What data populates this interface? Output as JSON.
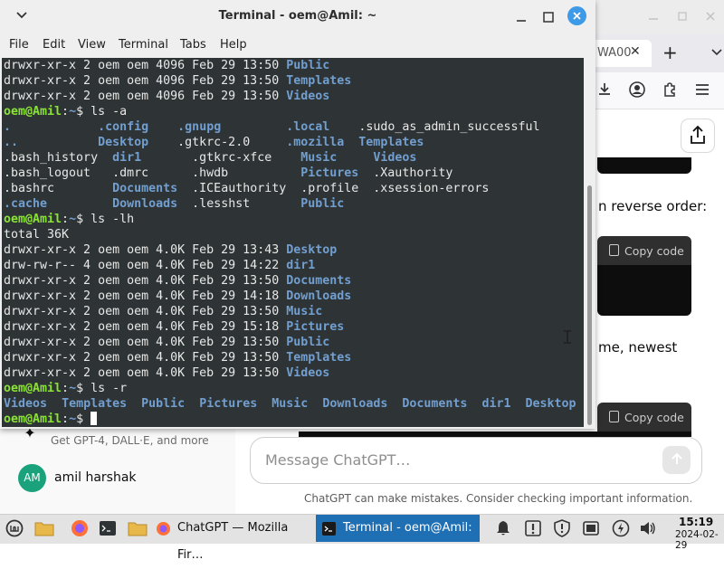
{
  "browser": {
    "tab_title": "WA00",
    "tab_close": "✕",
    "new_tab": "+",
    "content": {
      "text_reverse": "n reverse order:",
      "text_newest": "me, newest",
      "copy_code_1": "Copy code",
      "copy_code_2": "Copy code",
      "upgrade_subtitle": "Get GPT-4, DALL·E, and more",
      "user_initials": "AM",
      "user_name": "amil harshak",
      "message_placeholder": "Message ChatGPT…",
      "disclaimer": "ChatGPT can make mistakes. Consider checking important information."
    }
  },
  "terminal": {
    "title": "Terminal - oem@Amil: ~",
    "menu": [
      "File",
      "Edit",
      "View",
      "Terminal",
      "Tabs",
      "Help"
    ],
    "lines": [
      [
        {
          "t": "drwxr-xr-x 2 oem oem 4096 Feb 29 13:50 "
        },
        {
          "t": "Public",
          "c": "dir"
        }
      ],
      [
        {
          "t": "drwxr-xr-x 2 oem oem 4096 Feb 29 13:50 "
        },
        {
          "t": "Templates",
          "c": "dir"
        }
      ],
      [
        {
          "t": "drwxr-xr-x 2 oem oem 4096 Feb 29 13:50 "
        },
        {
          "t": "Videos",
          "c": "dir"
        }
      ],
      [
        {
          "t": "oem@Amil",
          "c": "prompt"
        },
        {
          "t": ":"
        },
        {
          "t": "~",
          "c": "dir"
        },
        {
          "t": "$ ls -a"
        }
      ],
      [
        {
          "t": ".",
          "c": "dir"
        },
        {
          "t": "            "
        },
        {
          "t": ".config",
          "c": "dir"
        },
        {
          "t": "    "
        },
        {
          "t": ".gnupg",
          "c": "dir"
        },
        {
          "t": "         "
        },
        {
          "t": ".local",
          "c": "dir"
        },
        {
          "t": "    .sudo_as_admin_successful"
        }
      ],
      [
        {
          "t": "..",
          "c": "dir"
        },
        {
          "t": "           "
        },
        {
          "t": "Desktop",
          "c": "dir"
        },
        {
          "t": "    .gtkrc-2.0     "
        },
        {
          "t": ".mozilla",
          "c": "dir"
        },
        {
          "t": "  "
        },
        {
          "t": "Templates",
          "c": "dir"
        }
      ],
      [
        {
          "t": ".bash_history  "
        },
        {
          "t": "dir1",
          "c": "dir"
        },
        {
          "t": "       .gtkrc-xfce    "
        },
        {
          "t": "Music",
          "c": "dir"
        },
        {
          "t": "     "
        },
        {
          "t": "Videos",
          "c": "dir"
        }
      ],
      [
        {
          "t": ".bash_logout   .dmrc      .hwdb          "
        },
        {
          "t": "Pictures",
          "c": "dir"
        },
        {
          "t": "  .Xauthority"
        }
      ],
      [
        {
          "t": ".bashrc        "
        },
        {
          "t": "Documents",
          "c": "dir"
        },
        {
          "t": "  .ICEauthority  .profile  .xsession-errors"
        }
      ],
      [
        {
          "t": ".cache",
          "c": "dir"
        },
        {
          "t": "         "
        },
        {
          "t": "Downloads",
          "c": "dir"
        },
        {
          "t": "  .lesshst       "
        },
        {
          "t": "Public",
          "c": "dir"
        }
      ],
      [
        {
          "t": "oem@Amil",
          "c": "prompt"
        },
        {
          "t": ":"
        },
        {
          "t": "~",
          "c": "dir"
        },
        {
          "t": "$ ls -lh"
        }
      ],
      [
        {
          "t": "total 36K"
        }
      ],
      [
        {
          "t": "drwxr-xr-x 2 oem oem 4.0K Feb 29 13:43 "
        },
        {
          "t": "Desktop",
          "c": "dir"
        }
      ],
      [
        {
          "t": "drw-rw-r-- 4 oem oem 4.0K Feb 29 14:22 "
        },
        {
          "t": "dir1",
          "c": "dir"
        }
      ],
      [
        {
          "t": "drwxr-xr-x 2 oem oem 4.0K Feb 29 13:50 "
        },
        {
          "t": "Documents",
          "c": "dir"
        }
      ],
      [
        {
          "t": "drwxr-xr-x 2 oem oem 4.0K Feb 29 14:18 "
        },
        {
          "t": "Downloads",
          "c": "dir"
        }
      ],
      [
        {
          "t": "drwxr-xr-x 2 oem oem 4.0K Feb 29 13:50 "
        },
        {
          "t": "Music",
          "c": "dir"
        }
      ],
      [
        {
          "t": "drwxr-xr-x 2 oem oem 4.0K Feb 29 15:18 "
        },
        {
          "t": "Pictures",
          "c": "dir"
        }
      ],
      [
        {
          "t": "drwxr-xr-x 2 oem oem 4.0K Feb 29 13:50 "
        },
        {
          "t": "Public",
          "c": "dir"
        }
      ],
      [
        {
          "t": "drwxr-xr-x 2 oem oem 4.0K Feb 29 13:50 "
        },
        {
          "t": "Templates",
          "c": "dir"
        }
      ],
      [
        {
          "t": "drwxr-xr-x 2 oem oem 4.0K Feb 29 13:50 "
        },
        {
          "t": "Videos",
          "c": "dir"
        }
      ],
      [
        {
          "t": "oem@Amil",
          "c": "prompt"
        },
        {
          "t": ":"
        },
        {
          "t": "~",
          "c": "dir"
        },
        {
          "t": "$ ls -r"
        }
      ],
      [
        {
          "t": "Videos",
          "c": "dir"
        },
        {
          "t": "  "
        },
        {
          "t": "Templates",
          "c": "dir"
        },
        {
          "t": "  "
        },
        {
          "t": "Public",
          "c": "dir"
        },
        {
          "t": "  "
        },
        {
          "t": "Pictures",
          "c": "dir"
        },
        {
          "t": "  "
        },
        {
          "t": "Music",
          "c": "dir"
        },
        {
          "t": "  "
        },
        {
          "t": "Downloads",
          "c": "dir"
        },
        {
          "t": "  "
        },
        {
          "t": "Documents",
          "c": "dir"
        },
        {
          "t": "  "
        },
        {
          "t": "dir1",
          "c": "dir"
        },
        {
          "t": "  "
        },
        {
          "t": "Desktop",
          "c": "dir"
        }
      ],
      [
        {
          "t": "oem@Amil",
          "c": "prompt"
        },
        {
          "t": ":"
        },
        {
          "t": "~",
          "c": "dir"
        },
        {
          "t": "$ "
        },
        {
          "t": "",
          "c": "cursor"
        }
      ]
    ],
    "colors": {
      "background": "#2e3436",
      "foreground": "#e8e8e8",
      "directory": "#729fcf",
      "prompt": "#8ae234"
    }
  },
  "taskbar": {
    "tasks": [
      {
        "label": "ChatGPT — Mozilla Fir…"
      },
      {
        "label": "Terminal - oem@Amil: ~"
      }
    ],
    "clock_time": "15:19",
    "clock_date": "2024-02-29"
  }
}
